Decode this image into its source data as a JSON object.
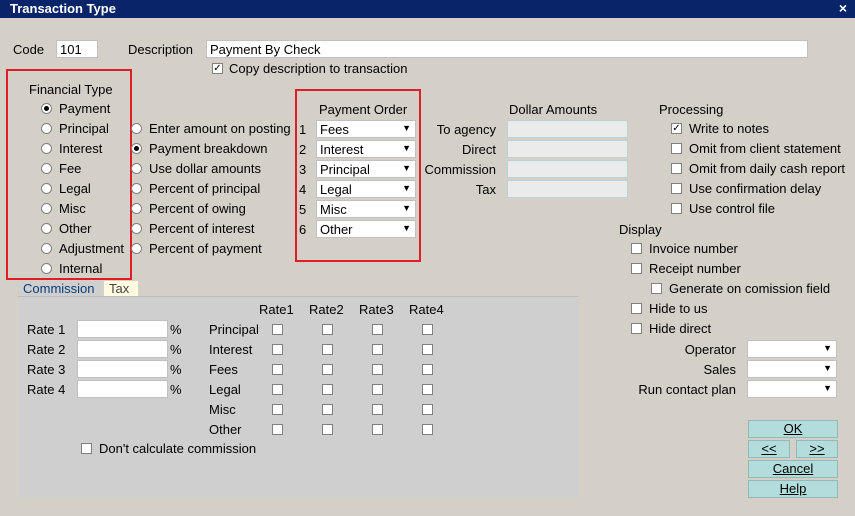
{
  "window": {
    "title": "Transaction Type",
    "close_glyph": "×"
  },
  "code": {
    "label": "Code",
    "value": "101"
  },
  "description": {
    "label": "Description",
    "value": "Payment By Check"
  },
  "copy_description": {
    "label": "Copy description to transaction",
    "checked": true
  },
  "financial_type": {
    "title": "Financial Type",
    "options": [
      "Payment",
      "Principal",
      "Interest",
      "Fee",
      "Legal",
      "Misc",
      "Other",
      "Adjustment",
      "Internal"
    ],
    "selected": "Payment"
  },
  "amount_mode": {
    "options": [
      "Enter amount on posting",
      "Payment breakdown",
      "Use dollar amounts",
      "Percent of principal",
      "Percent of owing",
      "Percent of interest",
      "Percent of payment"
    ],
    "selected": "Payment breakdown"
  },
  "payment_order": {
    "title": "Payment Order",
    "numbers": [
      "1",
      "2",
      "3",
      "4",
      "5",
      "6"
    ],
    "values": [
      "Fees",
      "Interest",
      "Principal",
      "Legal",
      "Misc",
      "Other"
    ]
  },
  "dollar_amounts": {
    "title": "Dollar Amounts",
    "labels": [
      "To agency",
      "Direct",
      "Commission",
      "Tax"
    ]
  },
  "processing": {
    "title": "Processing",
    "items": [
      {
        "label": "Write to notes",
        "checked": true
      },
      {
        "label": "Omit from client statement",
        "checked": false
      },
      {
        "label": "Omit from daily cash report",
        "checked": false
      },
      {
        "label": "Use confirmation delay",
        "checked": false
      },
      {
        "label": "Use control file",
        "checked": false
      }
    ]
  },
  "display": {
    "title": "Display",
    "invoice_number": "Invoice number",
    "receipt_number": "Receipt number",
    "generate_on_commission": "Generate on comission field",
    "hide_to_us": "Hide to us",
    "hide_direct": "Hide direct",
    "operator": "Operator",
    "sales": "Sales",
    "run_contact_plan": "Run contact plan"
  },
  "tabs": {
    "commission": "Commission",
    "tax": "Tax",
    "active": "Commission"
  },
  "commission": {
    "rate_labels": [
      "Rate 1",
      "Rate 2",
      "Rate 3",
      "Rate 4"
    ],
    "percent": "%",
    "columns": [
      "Rate1",
      "Rate2",
      "Rate3",
      "Rate4"
    ],
    "rows": [
      "Principal",
      "Interest",
      "Fees",
      "Legal",
      "Misc",
      "Other"
    ],
    "dont_calculate": "Don't calculate commission"
  },
  "buttons": {
    "ok": "OK",
    "prev": "<<",
    "next": ">>",
    "cancel": "Cancel",
    "help": "Help"
  },
  "colors": {
    "title_bar": "#0a246a",
    "highlight_box": "#e01c24",
    "button": "#b3dcdc"
  },
  "icons": {
    "dropdown": "chevron-down-icon",
    "check": "checkmark-icon"
  }
}
